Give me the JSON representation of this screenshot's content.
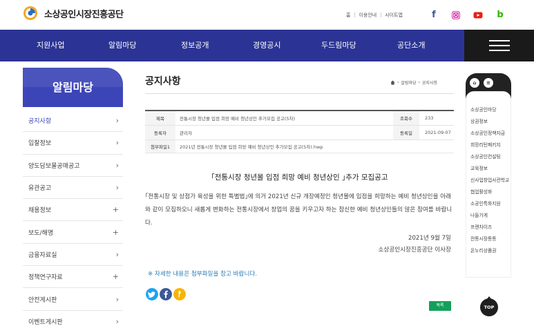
{
  "header": {
    "logo_text": "소상공인시장진흥공단",
    "util_links": [
      "홈",
      "이용안내",
      "사이트맵"
    ],
    "sns": [
      "facebook-icon",
      "instagram-icon",
      "youtube-icon",
      "blog-icon"
    ]
  },
  "nav": {
    "items": [
      "지원사업",
      "알림마당",
      "정보공개",
      "경영공시",
      "두드림마당",
      "공단소개"
    ]
  },
  "sidebar": {
    "title": "알림마당",
    "items": [
      {
        "label": "공지사항",
        "mark": "›"
      },
      {
        "label": "입찰정보",
        "mark": "›"
      },
      {
        "label": "양도담보물공매공고",
        "mark": "›"
      },
      {
        "label": "유관공고",
        "mark": "›"
      },
      {
        "label": "채용정보",
        "mark": "+"
      },
      {
        "label": "보도/해명",
        "mark": "+"
      },
      {
        "label": "금융자료실",
        "mark": "›"
      },
      {
        "label": "정책연구자료",
        "mark": "+"
      },
      {
        "label": "안전게시판",
        "mark": "›"
      },
      {
        "label": "이벤트게시판",
        "mark": "›"
      }
    ]
  },
  "main": {
    "page_title": "공지사항",
    "breadcrumb": [
      "알림마당",
      "공지사항"
    ],
    "info": {
      "subject_label": "제목",
      "subject": "전통시장 청년몰 입점 희망 예비 청년상인 추가모집 공고(5차)",
      "views_label": "조회수",
      "views": "233",
      "author_label": "등록자",
      "author": "관리자",
      "date_label": "등록일",
      "date": "2021-09-07",
      "file_label": "첨부파일1",
      "file": "2021년 전통시장 청년몰 입점 희망 예비 청년상인 추가모집 공고(5차).hwp"
    },
    "post": {
      "heading": "｢전통시장 청년몰 입점 희망 예비 청년상인 ｣추가 모집공고",
      "body": "｢전통시장 및 상점가 육성을 위한 특별법｣에 의거 2021년 신규 개장예정인 청년몰에 입점을 희망하는 예비 청년상인을 아래와 같이 모집하오니 새롭게 변화하는 전통시장에서 창업의 꿈을 키우고자 하는 참신한 예비 청년상인들의 많은 참여를 바랍니다.",
      "date": "2021년  9월  7일",
      "signature": "소상공인시장진흥공단 이사장",
      "notice": "※ 자세한 내용은 첨부파일을 참고 바랍니다."
    },
    "share": [
      "twitter-icon",
      "facebook-icon",
      "kakaostory-icon"
    ],
    "list_button": "목록"
  },
  "quick": {
    "items": [
      "소상공인마당",
      "상권정보",
      "소상공인정책자금",
      "희망리턴패키지",
      "소상공인컨설팅",
      "교육정보",
      "신사업창업사관학교",
      "협업활성화",
      "소공인특화지원",
      "나들가게",
      "프랜차이즈",
      "전통시장통통",
      "온누리상품권"
    ],
    "top_label": "TOP"
  },
  "colors": {
    "nav_bg": "#2b3494",
    "sidebar_title_bg": "#3c45b8",
    "list_button": "#14a05a",
    "notice": "#2b7db8"
  }
}
